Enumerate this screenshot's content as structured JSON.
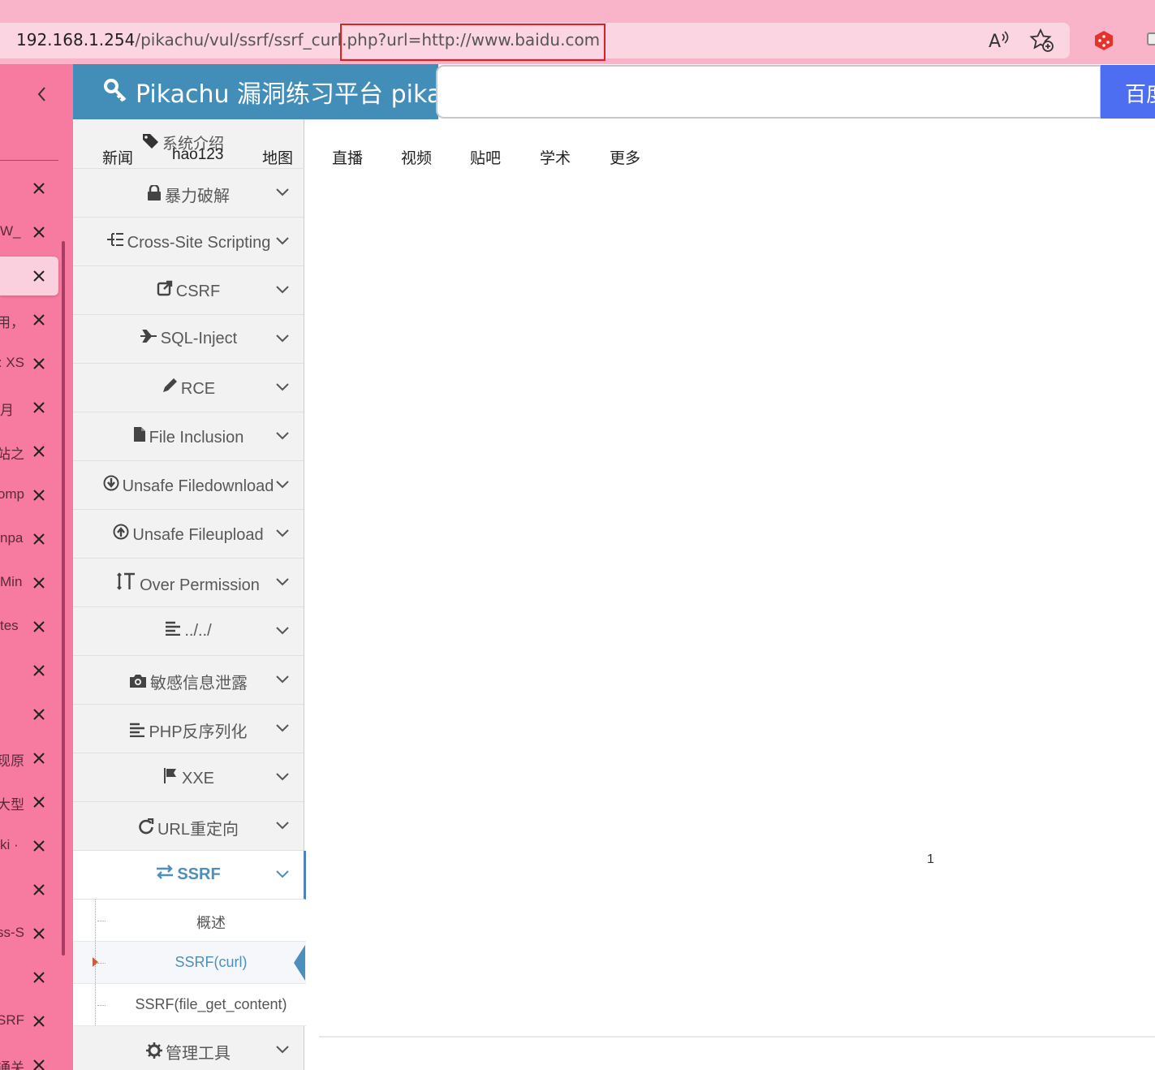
{
  "browser": {
    "url_host": "192.168.1.254",
    "url_path": "/pikachu/vul/ssrf/ssrf_curl.php?url=http://www.baidu.com"
  },
  "tabs": [
    {
      "title": "",
      "active": false
    },
    {
      "title": "_W",
      "active": false
    },
    {
      "title": "",
      "active": true
    },
    {
      "title": "，用",
      "active": false
    },
    {
      "title": "r: XS",
      "active": false
    },
    {
      "title": "月",
      "active": false
    },
    {
      "title": "站之",
      "active": false
    },
    {
      "title": "omp",
      "active": false
    },
    {
      "title": "npa",
      "active": false
    },
    {
      "title": "Min",
      "active": false
    },
    {
      "title": "tes",
      "active": false
    },
    {
      "title": "",
      "active": false
    },
    {
      "title": "",
      "active": false
    },
    {
      "title": "现原",
      "active": false
    },
    {
      "title": "大型",
      "active": false
    },
    {
      "title": "· ki",
      "active": false
    },
    {
      "title": "",
      "active": false
    },
    {
      "title": "ss-S",
      "active": false
    },
    {
      "title": "",
      "active": false
    },
    {
      "title": "SRF",
      "active": false
    },
    {
      "title": "通关",
      "active": false
    }
  ],
  "header": {
    "title": "Pikachu 漏洞练习平台 pika~"
  },
  "baidu": {
    "search_button": "百度一下",
    "nav_left": [
      "新闻",
      "hao123",
      "地图"
    ],
    "nav_main": [
      "直播",
      "视频",
      "贴吧",
      "学术",
      "更多"
    ]
  },
  "sidebar": {
    "intro": "系统介绍",
    "items": [
      {
        "label": "暴力破解",
        "icon": "lock-icon"
      },
      {
        "label": "Cross-Site Scripting",
        "icon": "sitemap-icon"
      },
      {
        "label": "CSRF",
        "icon": "share-icon"
      },
      {
        "label": "SQL-Inject",
        "icon": "plane-icon"
      },
      {
        "label": "RCE",
        "icon": "pencil-icon"
      },
      {
        "label": "File Inclusion",
        "icon": "file-icon"
      },
      {
        "label": "Unsafe Filedownload",
        "icon": "download-icon"
      },
      {
        "label": "Unsafe Fileupload",
        "icon": "upload-icon"
      },
      {
        "label": "Over Permission",
        "icon": "text-height-icon"
      },
      {
        "label": "../../",
        "icon": "align-left-icon"
      },
      {
        "label": "敏感信息泄露",
        "icon": "camera-icon"
      },
      {
        "label": "PHP反序列化",
        "icon": "align-left-icon"
      },
      {
        "label": "XXE",
        "icon": "flag-icon"
      },
      {
        "label": "URL重定向",
        "icon": "refresh-icon"
      },
      {
        "label": "SSRF",
        "icon": "exchange-icon"
      },
      {
        "label": "管理工具",
        "icon": "gear-icon"
      }
    ],
    "ssrf_sub": [
      "概述",
      "SSRF(curl)",
      "SSRF(file_get_content)"
    ]
  },
  "main": {
    "page_number": "1"
  }
}
